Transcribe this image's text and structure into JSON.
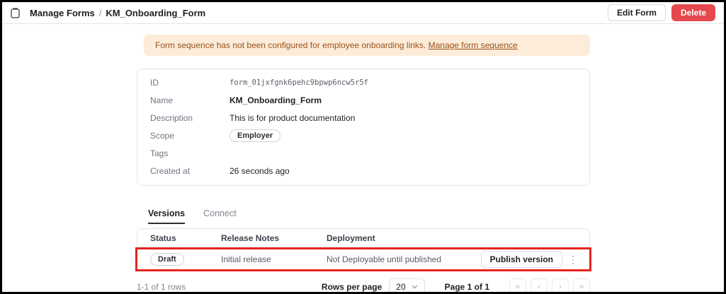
{
  "colors": {
    "delete_button_bg": "#e5484d",
    "banner_bg": "#fcecd9",
    "banner_text": "#99501a",
    "highlight_annotation": "#e52521",
    "border": "#e4e5e9"
  },
  "header": {
    "breadcrumb_root": "Manage Forms",
    "breadcrumb_separator": "/",
    "breadcrumb_current": "KM_Onboarding_Form",
    "edit_button_label": "Edit Form",
    "delete_button_label": "Delete"
  },
  "banner": {
    "message": "Form sequence has not been configured for employee onboarding links.",
    "link_label": "Manage form sequence"
  },
  "details": {
    "fields": [
      {
        "label": "ID",
        "value": "form_01jxfgnk6pehc9bpwp6ncw5r5f"
      },
      {
        "label": "Name",
        "value": "KM_Onboarding_Form"
      },
      {
        "label": "Description",
        "value": "This is for product documentation"
      },
      {
        "label": "Scope",
        "value": "Employer"
      },
      {
        "label": "Tags",
        "value": ""
      },
      {
        "label": "Created at",
        "value": "26 seconds ago"
      }
    ]
  },
  "tabs": [
    {
      "label": "Versions",
      "active": true
    },
    {
      "label": "Connect",
      "active": false
    }
  ],
  "versions_table": {
    "columns": [
      "Status",
      "Release Notes",
      "Deployment"
    ],
    "rows": [
      {
        "status": "Draft",
        "release_notes": "Initial release",
        "deployment": "Not Deployable until published",
        "action_label": "Publish version",
        "menu_icon": "⋮"
      }
    ]
  },
  "pagination": {
    "range_text": "1-1 of 1 rows",
    "rows_per_page_label": "Rows per page",
    "rows_per_page_value": "20",
    "page_text": "Page 1 of 1",
    "first_icon": "«",
    "prev_icon": "‹",
    "next_icon": "›",
    "last_icon": "»"
  }
}
